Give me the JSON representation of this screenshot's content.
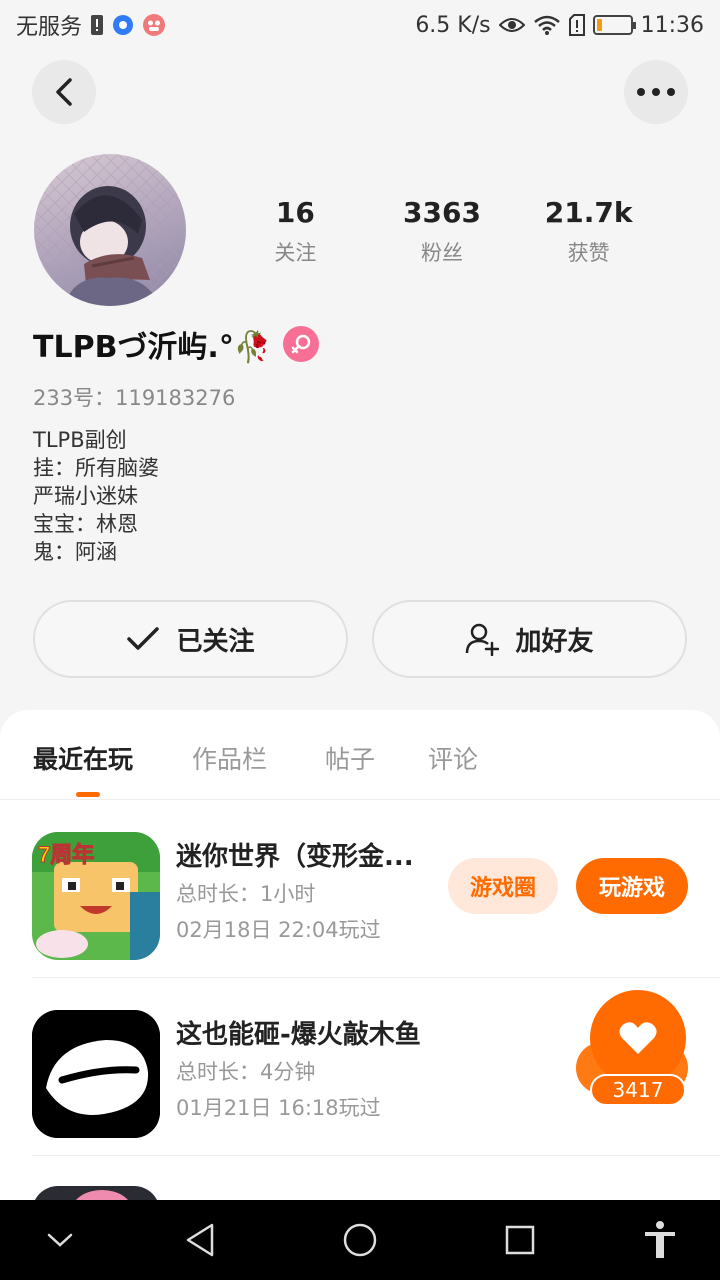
{
  "status_bar": {
    "carrier": "无服务",
    "net_speed": "6.5 K/s",
    "time": "11:36",
    "battery_level": 0.18
  },
  "profile": {
    "stats": [
      {
        "value": "16",
        "label": "关注"
      },
      {
        "value": "3363",
        "label": "粉丝"
      },
      {
        "value": "21.7k",
        "label": "获赞"
      }
    ],
    "nickname": "TLPBづ沂屿.°🥀",
    "uid_label": "233号：",
    "uid_value": "119183276",
    "bio": [
      "TLPB副创",
      "挂：所有脑婆",
      "严瑞小迷妹",
      "宝宝：林恩",
      "鬼：阿涵"
    ],
    "gender_icon": "female-icon"
  },
  "actions": {
    "follow_label": "已关注",
    "add_friend_label": "加好友"
  },
  "tabs": [
    "最近在玩",
    "作品栏",
    "帖子",
    "评论"
  ],
  "games": [
    {
      "title": "迷你世界（变形金...",
      "duration": "总时长：1小时",
      "last_played": "02月18日 22:04玩过",
      "circle_label": "游戏圈",
      "play_label": "玩游戏",
      "icon_badge": "7周年"
    },
    {
      "title": "这也能砸-爆火敲木鱼",
      "duration": "总时长：4分钟",
      "last_played": "01月21日 16:18玩过",
      "like_count": "3417"
    }
  ],
  "colors": {
    "accent": "#ff6b00",
    "accent_light": "#ffe8d9",
    "gender_pink": "#f76f95"
  }
}
